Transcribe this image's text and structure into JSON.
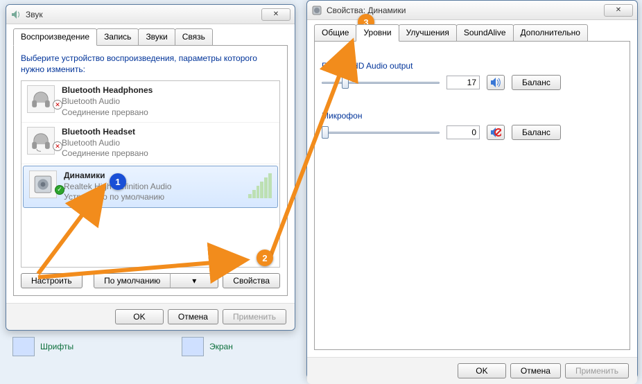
{
  "window1": {
    "title": "Звук",
    "tabs": [
      "Воспроизведение",
      "Запись",
      "Звуки",
      "Связь"
    ],
    "instruction": "Выберите устройство воспроизведения, параметры которого нужно изменить:",
    "devices": [
      {
        "name": "Bluetooth Headphones",
        "sub": "Bluetooth Audio",
        "status": "Соединение прервано",
        "badge": "✕"
      },
      {
        "name": "Bluetooth Headset",
        "sub": "Bluetooth Audio",
        "status": "Соединение прервано",
        "badge": "✕"
      },
      {
        "name": "Динамики",
        "sub": "Realtek High Definition Audio",
        "status": "Устройство по умолчанию",
        "badge": "✓"
      }
    ],
    "buttons": {
      "configure": "Настроить",
      "default": "По умолчанию",
      "properties": "Свойства"
    },
    "dlg": {
      "ok": "OK",
      "cancel": "Отмена",
      "apply": "Применить"
    }
  },
  "window2": {
    "title": "Свойства: Динамики",
    "tabs": [
      "Общие",
      "Уровни",
      "Улучшения",
      "SoundAlive",
      "Дополнительно"
    ],
    "sliders": [
      {
        "label": "Realtek HD Audio output",
        "value": "17",
        "pos_pct": 17,
        "muted": false
      },
      {
        "label": "Микрофон",
        "value": "0",
        "pos_pct": 0,
        "muted": true
      }
    ],
    "balance": "Баланс",
    "dlg": {
      "ok": "OK",
      "cancel": "Отмена",
      "apply": "Применить"
    }
  },
  "desktop": {
    "fonts": "Шрифты",
    "screen": "Экран"
  },
  "annotations": {
    "a1": "1",
    "a2": "2",
    "a3": "3"
  }
}
